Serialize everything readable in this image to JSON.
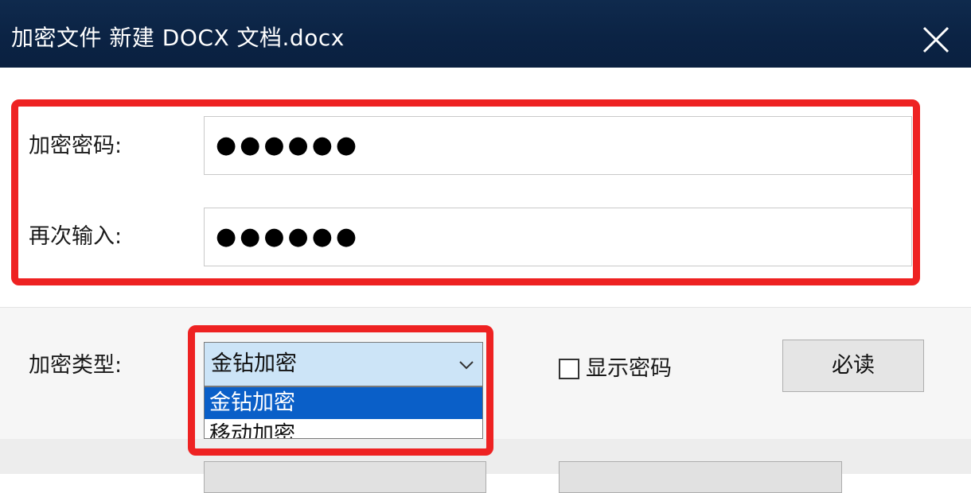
{
  "window": {
    "title": "加密文件 新建 DOCX 文档.docx",
    "close_icon": "close-icon"
  },
  "form": {
    "password_label": "加密密码:",
    "password_value": "●●●●●●",
    "confirm_label": "再次输入:",
    "confirm_value": "●●●●●●",
    "encrypt_type_label": "加密类型:",
    "encrypt_type_selected": "金钻加密",
    "encrypt_type_options": [
      "金钻加密",
      "移动加密"
    ],
    "show_password_label": "显示密码",
    "show_password_checked": false,
    "must_read_button": "必读"
  },
  "colors": {
    "titlebar": "#0b2344",
    "highlight": "#ee2222",
    "selection": "#0a5fc8",
    "combo_focus": "#cce4f7"
  }
}
